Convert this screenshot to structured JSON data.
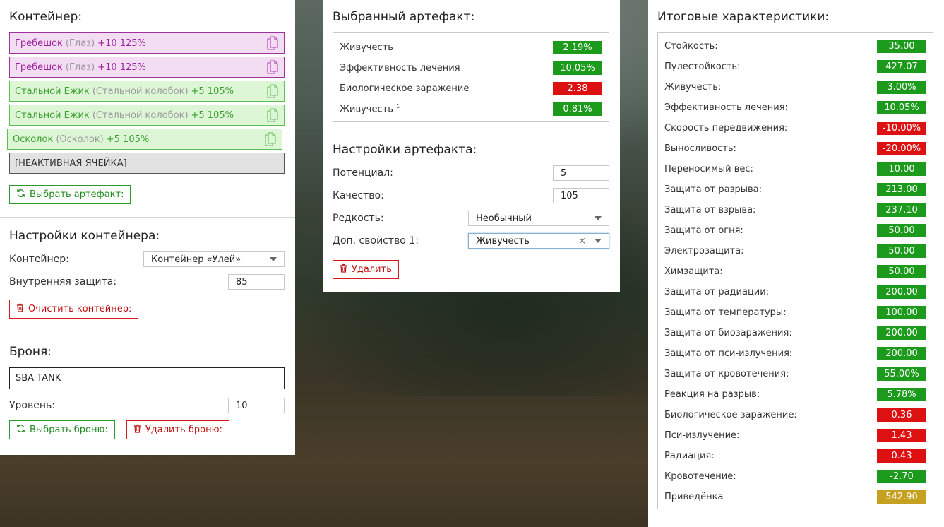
{
  "container": {
    "title": "Контейнер:",
    "slots": [
      {
        "name": "Гребешок",
        "sub": "(Глаз)",
        "bonus": "+10 125%",
        "style": "purple"
      },
      {
        "name": "Гребешок",
        "sub": "(Глаз)",
        "bonus": "+10 125%",
        "style": "purple"
      },
      {
        "name": "Стальной Ежик",
        "sub": "(Стальной колобок)",
        "bonus": "+5 105%",
        "style": "green"
      },
      {
        "name": "Стальной Ежик",
        "sub": "(Стальной колобок)",
        "bonus": "+5 105%",
        "style": "green"
      },
      {
        "name": "Осколок",
        "sub": "(Осколок)",
        "bonus": "+5 105%",
        "style": "green"
      },
      {
        "name": "[НЕАКТИВНАЯ ЯЧЕЙКА]",
        "style": "gray"
      }
    ],
    "choose_artifact": "Выбрать артефакт:"
  },
  "container_settings": {
    "title": "Настройки контейнера:",
    "container_label": "Контейнер:",
    "container_value": "Контейнер «Улей»",
    "inner_protection_label": "Внутренняя защита:",
    "inner_protection_value": "85",
    "clear_button": "Очистить контейнер:"
  },
  "armor": {
    "title": "Броня:",
    "name": "SBA TANK",
    "level_label": "Уровень:",
    "level_value": "10",
    "choose_button": "Выбрать броню:",
    "delete_button": "Удалить броню:"
  },
  "selected_artifact": {
    "title": "Выбранный артефакт:",
    "stats": [
      {
        "label": "Живучесть",
        "value": "2.19%",
        "color": "g"
      },
      {
        "label": "Эффективность лечения",
        "value": "10.05%",
        "color": "g"
      },
      {
        "label": "Биологическое заражение",
        "value": "2.38",
        "color": "r"
      },
      {
        "label": "Живучесть",
        "sup": "1",
        "value": "0.81%",
        "color": "g"
      }
    ]
  },
  "artifact_settings": {
    "title": "Настройки артефакта:",
    "potential_label": "Потенциал:",
    "potential_value": "5",
    "quality_label": "Качество:",
    "quality_value": "105",
    "rarity_label": "Редкость:",
    "rarity_value": "Необычный",
    "extra_label": "Доп. свойство 1:",
    "extra_value": "Живучесть",
    "clear_x": "×",
    "delete_button": "Удалить"
  },
  "totals": {
    "title": "Итоговые характеристики:",
    "stats": [
      {
        "label": "Стойкость:",
        "value": "35.00",
        "color": "g"
      },
      {
        "label": "Пулестойкость:",
        "value": "427.07",
        "color": "g"
      },
      {
        "label": "Живучесть:",
        "value": "3.00%",
        "color": "g"
      },
      {
        "label": "Эффективность лечения:",
        "value": "10.05%",
        "color": "g"
      },
      {
        "label": "Скорость передвижения:",
        "value": "-10.00%",
        "color": "r"
      },
      {
        "label": "Выносливость:",
        "value": "-20.00%",
        "color": "r"
      },
      {
        "label": "Переносимый вес:",
        "value": "10.00",
        "color": "g"
      },
      {
        "label": "Защита от разрыва:",
        "value": "213.00",
        "color": "g"
      },
      {
        "label": "Защита от взрыва:",
        "value": "237.10",
        "color": "g"
      },
      {
        "label": "Защита от огня:",
        "value": "50.00",
        "color": "g"
      },
      {
        "label": "Электрозащита:",
        "value": "50.00",
        "color": "g"
      },
      {
        "label": "Химзащита:",
        "value": "50.00",
        "color": "g"
      },
      {
        "label": "Защита от радиации:",
        "value": "200.00",
        "color": "g"
      },
      {
        "label": "Защита от температуры:",
        "value": "100.00",
        "color": "g"
      },
      {
        "label": "Защита от биозаражения:",
        "value": "200.00",
        "color": "g"
      },
      {
        "label": "Защита от пси-излучения:",
        "value": "200.00",
        "color": "g"
      },
      {
        "label": "Защита от кровотечения:",
        "value": "55.00%",
        "color": "g"
      },
      {
        "label": "Реакция на разрыв:",
        "value": "5.78%",
        "color": "g"
      },
      {
        "label": "Биологическое заражение:",
        "value": "0.36",
        "color": "r"
      },
      {
        "label": "Пси-излучение:",
        "value": "1.43",
        "color": "r"
      },
      {
        "label": "Радиация:",
        "value": "0.43",
        "color": "r"
      },
      {
        "label": "Кровотечение:",
        "value": "-2.70",
        "color": "g"
      },
      {
        "label": "Приведёнка",
        "value": "542.90",
        "color": "y"
      }
    ]
  }
}
